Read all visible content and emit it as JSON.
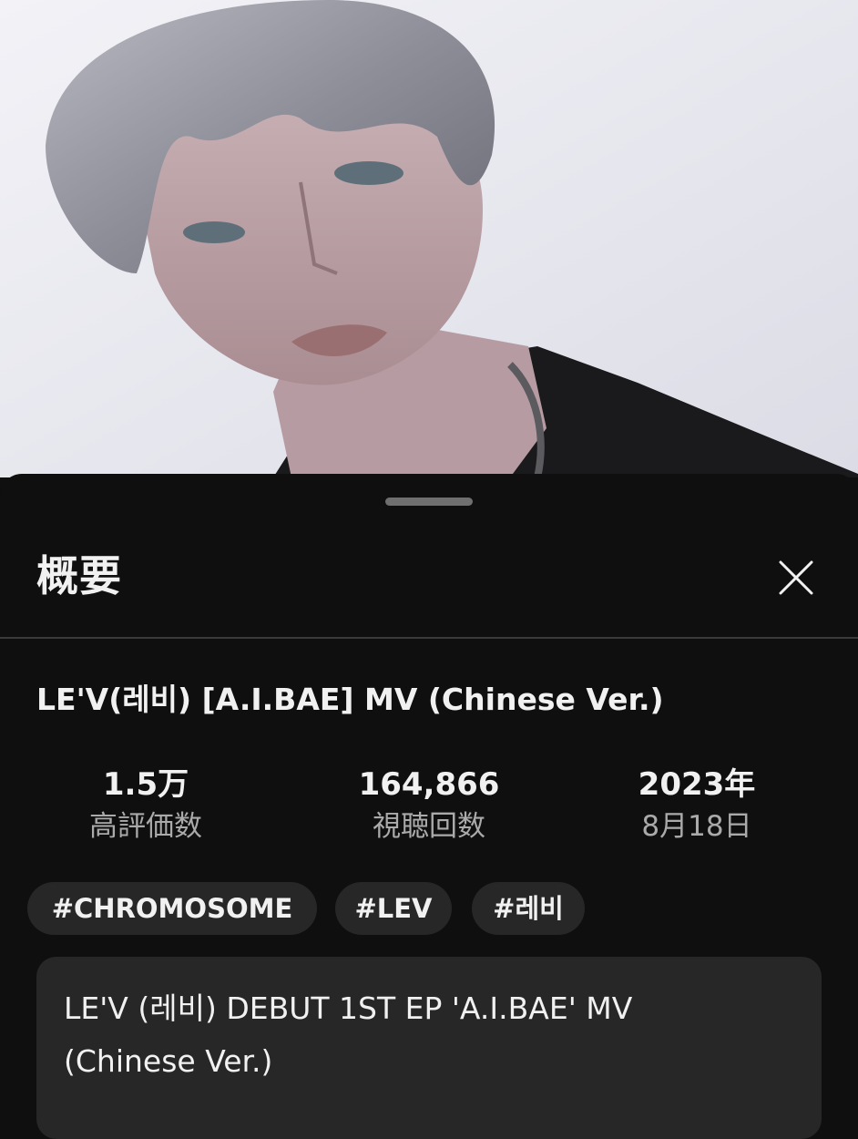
{
  "video": {
    "thumbnail_icon": "music-video-thumbnail"
  },
  "sheet": {
    "title": "概要",
    "close_icon": "close-icon"
  },
  "video_info": {
    "title": "LE'V(레비) [A.I.BAE] MV (Chinese Ver.)",
    "stats": [
      {
        "value": "1.5万",
        "label": "高評価数"
      },
      {
        "value": "164,866",
        "label": "視聴回数"
      },
      {
        "value": "2023年",
        "label": "8月18日"
      }
    ],
    "hashtags": [
      "#CHROMOSOME",
      "#LEV",
      "#레비"
    ],
    "description_lines": [
      "LE'V (레비) DEBUT 1ST EP 'A.I.BAE' MV",
      "(Chinese Ver.)"
    ]
  },
  "colors": {
    "background": "#0f0f0f",
    "chip": "#272727",
    "secondary_text": "#aaaaaa"
  }
}
